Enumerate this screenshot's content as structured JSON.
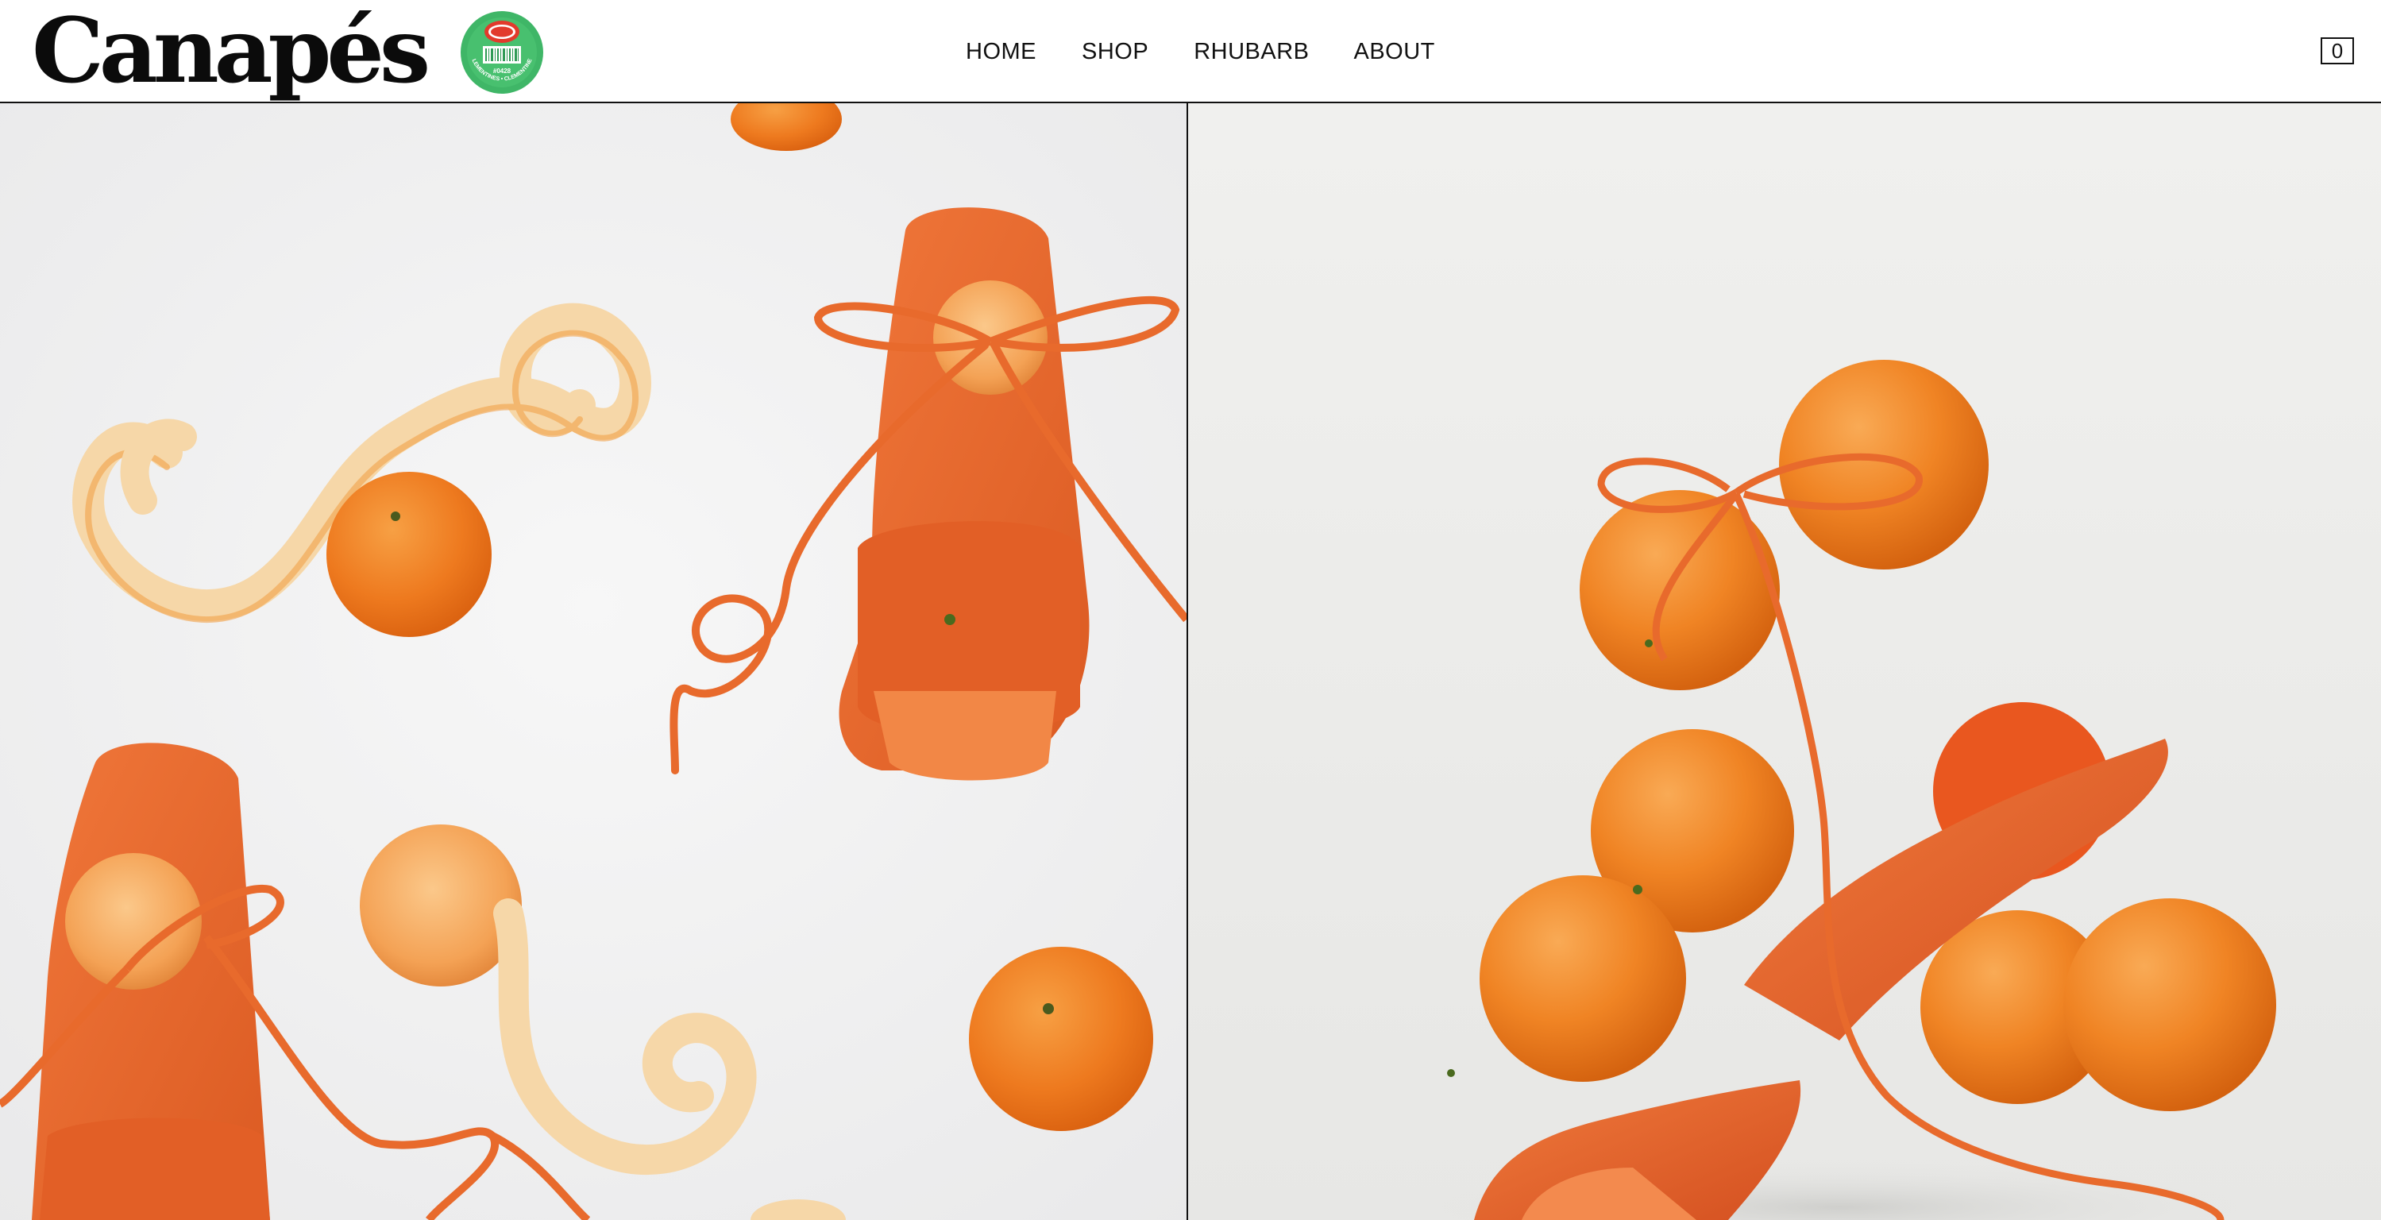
{
  "brand": {
    "logo_text": "Canapés",
    "sticker_label": "CLEMENTINES • CLEMENTINES",
    "sticker_code": "#0428"
  },
  "nav": {
    "items": [
      {
        "label": "HOME"
      },
      {
        "label": "SHOP"
      },
      {
        "label": "RHUBARB"
      },
      {
        "label": "ABOUT"
      }
    ]
  },
  "cart": {
    "count": "0"
  },
  "colors": {
    "accent_orange": "#e86a2c",
    "background": "#ffffff",
    "text": "#111111"
  },
  "gallery": {
    "images": [
      {
        "name": "clementine-sandals-flatlay"
      },
      {
        "name": "clementine-stack-sandal"
      }
    ]
  }
}
